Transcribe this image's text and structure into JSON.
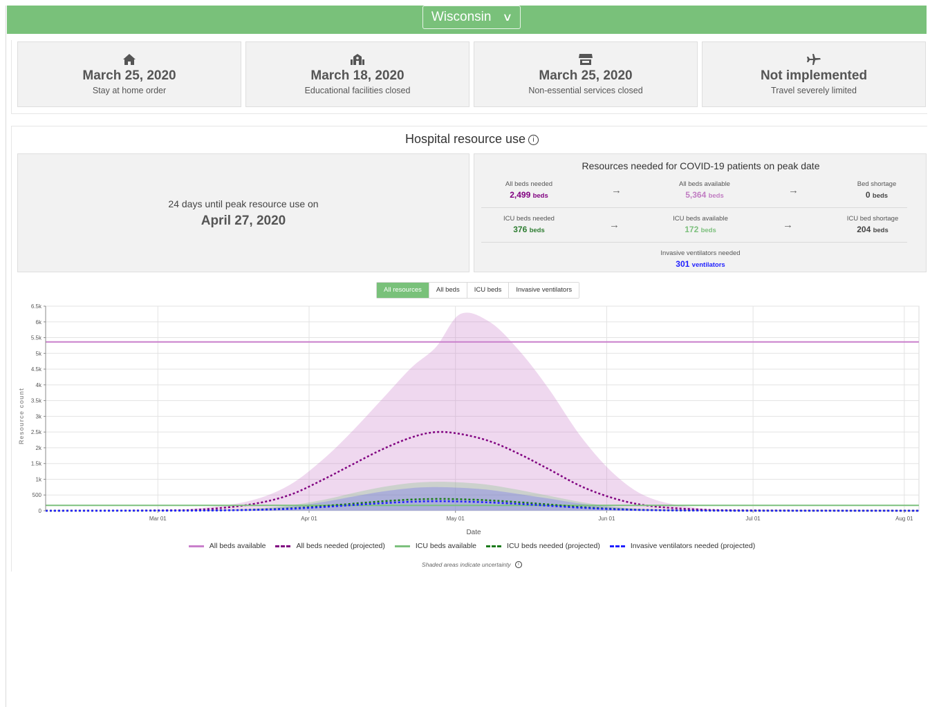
{
  "header": {
    "state": "Wisconsin"
  },
  "policies": [
    {
      "icon": "home-icon",
      "date": "March 25, 2020",
      "label": "Stay at home order"
    },
    {
      "icon": "school-icon",
      "date": "March 18, 2020",
      "label": "Educational facilities closed"
    },
    {
      "icon": "store-icon",
      "date": "March 25, 2020",
      "label": "Non-essential services closed"
    },
    {
      "icon": "airplane-icon",
      "date": "Not implemented",
      "label": "Travel severely limited"
    }
  ],
  "hospital": {
    "title": "Hospital resource use",
    "peak_days": "24",
    "peak_text": "days until peak resource use on",
    "peak_date": "April 27, 2020",
    "resources_title": "Resources needed for COVID-19 patients on peak date",
    "all_beds_needed_label": "All beds needed",
    "all_beds_needed": "2,499",
    "all_beds_needed_unit": "beds",
    "all_beds_available_label": "All beds available",
    "all_beds_available": "5,364",
    "all_beds_available_unit": "beds",
    "bed_shortage_label": "Bed shortage",
    "bed_shortage": "0",
    "bed_shortage_unit": "beds",
    "icu_needed_label": "ICU beds needed",
    "icu_needed": "376",
    "icu_needed_unit": "beds",
    "icu_available_label": "ICU beds available",
    "icu_available": "172",
    "icu_available_unit": "beds",
    "icu_shortage_label": "ICU bed shortage",
    "icu_shortage": "204",
    "icu_shortage_unit": "beds",
    "vent_label": "Invasive ventilators needed",
    "vent": "301",
    "vent_unit": "ventilators"
  },
  "tabs": [
    "All resources",
    "All beds",
    "ICU beds",
    "Invasive ventilators"
  ],
  "active_tab": "All resources",
  "footnote": "Shaded areas indicate uncertainty",
  "colors": {
    "topbar": "#79c17a",
    "all_beds_available": "#c97fcb",
    "all_beds_needed": "#800080",
    "icu_available": "#7cc07d",
    "icu_needed": "#1a7a1a",
    "vent_needed": "#1f1fff"
  },
  "chart_data": {
    "type": "line",
    "xlabel": "Date",
    "ylabel": "Resource count",
    "ylim": [
      0,
      6500
    ],
    "yticks": [
      0,
      500,
      1000,
      1500,
      2000,
      2500,
      3000,
      3500,
      4000,
      4500,
      5000,
      5500,
      6000,
      6500
    ],
    "ytick_labels": [
      "0",
      "500",
      "1k",
      "1.5k",
      "2k",
      "2.5k",
      "3k",
      "3.5k",
      "4k",
      "4.5k",
      "5k",
      "5.5k",
      "6k",
      "6.5k"
    ],
    "xlim": [
      "2020-02-07",
      "2020-08-04"
    ],
    "xticks": [
      "2020-03-01",
      "2020-04-01",
      "2020-05-01",
      "2020-06-01",
      "2020-07-01",
      "2020-08-01"
    ],
    "xtick_labels": [
      "Mar 01",
      "Apr 01",
      "May 01",
      "Jun 01",
      "Jul 01",
      "Aug 01"
    ],
    "grid": true,
    "legend_position": "bottom",
    "x": [
      "2020-02-07",
      "2020-03-01",
      "2020-03-10",
      "2020-03-20",
      "2020-03-28",
      "2020-04-04",
      "2020-04-10",
      "2020-04-16",
      "2020-04-22",
      "2020-04-27",
      "2020-05-02",
      "2020-05-08",
      "2020-05-14",
      "2020-05-20",
      "2020-05-27",
      "2020-06-03",
      "2020-06-10",
      "2020-06-20",
      "2020-07-01",
      "2020-08-04"
    ],
    "series": [
      {
        "name": "All beds available",
        "style": "solid",
        "values": [
          5364,
          5364,
          5364,
          5364,
          5364,
          5364,
          5364,
          5364,
          5364,
          5364,
          5364,
          5364,
          5364,
          5364,
          5364,
          5364,
          5364,
          5364,
          5364,
          5364
        ]
      },
      {
        "name": "All beds needed (projected)",
        "style": "dashed",
        "values": [
          0,
          10,
          40,
          200,
          500,
          1000,
          1480,
          1950,
          2330,
          2499,
          2440,
          2210,
          1810,
          1330,
          760,
          370,
          150,
          40,
          10,
          0
        ]
      },
      {
        "name": "ICU beds available",
        "style": "solid",
        "values": [
          172,
          172,
          172,
          172,
          172,
          172,
          172,
          172,
          172,
          172,
          172,
          172,
          172,
          172,
          172,
          172,
          172,
          172,
          172,
          172
        ]
      },
      {
        "name": "ICU beds needed (projected)",
        "style": "dashed",
        "values": [
          0,
          2,
          6,
          30,
          75,
          150,
          225,
          300,
          355,
          376,
          365,
          330,
          270,
          200,
          115,
          55,
          22,
          6,
          1,
          0
        ]
      },
      {
        "name": "Invasive ventilators needed (projected)",
        "style": "dashed",
        "values": [
          0,
          2,
          5,
          24,
          60,
          120,
          180,
          240,
          285,
          301,
          292,
          264,
          216,
          160,
          92,
          44,
          18,
          5,
          1,
          0
        ]
      }
    ],
    "uncertainty": {
      "all_beds_upper": [
        0,
        20,
        90,
        320,
        820,
        1650,
        2550,
        3550,
        4550,
        5200,
        6250,
        6000,
        5100,
        3900,
        2300,
        1100,
        400,
        80,
        10,
        0
      ],
      "icu_upper": [
        0,
        5,
        15,
        60,
        170,
        350,
        560,
        750,
        880,
        920,
        900,
        820,
        660,
        480,
        270,
        120,
        45,
        10,
        2,
        0
      ],
      "vent_upper": [
        0,
        4,
        12,
        48,
        135,
        280,
        450,
        610,
        720,
        750,
        730,
        660,
        530,
        390,
        220,
        100,
        38,
        8,
        1,
        0
      ]
    }
  }
}
